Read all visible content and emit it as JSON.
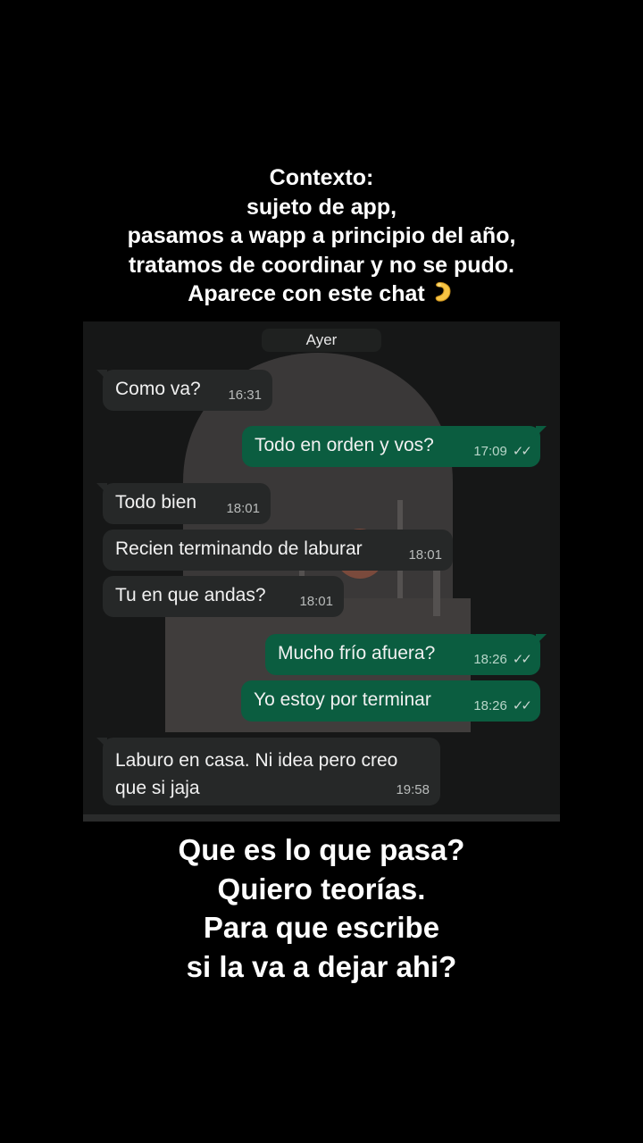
{
  "caption_top": {
    "lines": [
      "Contexto:",
      "sujeto de app,",
      "pasamos a wapp a principio del año,",
      "tratamos de coordinar y no se pudo.",
      "Aparece con este chat"
    ],
    "emoji": "pinched-fingers-hand-emoji"
  },
  "chat": {
    "date_chip": "Ayer",
    "messages": [
      {
        "direction": "in",
        "text": "Como va?",
        "time": "16:31"
      },
      {
        "direction": "out",
        "text": "Todo en orden y vos?",
        "time": "17:09",
        "status": "double-check-icon"
      },
      {
        "direction": "in",
        "text": "Todo bien",
        "time": "18:01"
      },
      {
        "direction": "in",
        "text": "Recien terminando de laburar",
        "time": "18:01"
      },
      {
        "direction": "in",
        "text": "Tu en que andas?",
        "time": "18:01"
      },
      {
        "direction": "out",
        "text": "Mucho frío afuera?",
        "time": "18:26",
        "status": "double-check-icon"
      },
      {
        "direction": "out",
        "text": "Yo estoy por terminar",
        "time": "18:26",
        "status": "double-check-icon"
      },
      {
        "direction": "in",
        "text": "Laburo en casa. Ni idea pero creo que si jaja",
        "time": "19:58"
      }
    ],
    "colors": {
      "incoming_bubble": "#262828",
      "outgoing_bubble": "#0b5d40",
      "background": "#161717"
    }
  },
  "caption_bottom": {
    "lines": [
      "Que es lo que pasa?",
      "Quiero teorías.",
      "Para que escribe",
      "si la va a dejar ahi?"
    ]
  }
}
